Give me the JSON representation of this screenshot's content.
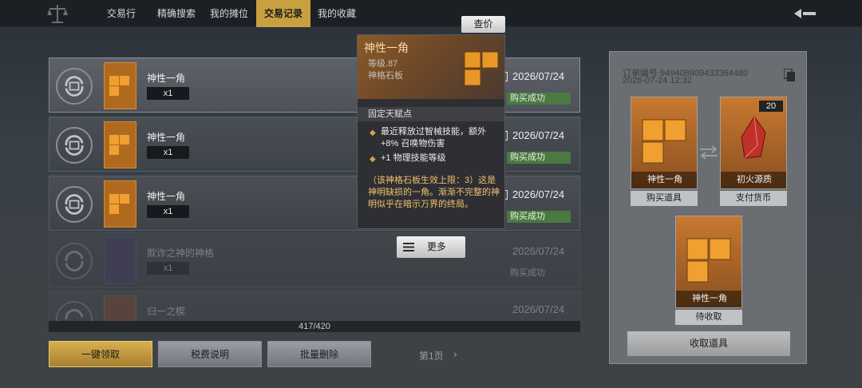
{
  "tabs": [
    {
      "label": "交易行"
    },
    {
      "label": "精确搜索"
    },
    {
      "label": "我的摊位"
    },
    {
      "label": "交易记录"
    },
    {
      "label": "我的收藏"
    }
  ],
  "active_tab_index": 3,
  "records": [
    {
      "name": "神性一角",
      "qty": "x1",
      "date": "2026/07/24",
      "status": "购买成功"
    },
    {
      "name": "神性一角",
      "qty": "x1",
      "date": "2026/07/24",
      "status": "购买成功"
    },
    {
      "name": "神性一角",
      "qty": "x1",
      "date": "2026/07/24",
      "status": "购买成功"
    },
    {
      "name": "欺诈之神的神格",
      "qty": "x1",
      "date": "2026/07/24",
      "status": "购买成功"
    },
    {
      "name": "归一之楔",
      "qty": "",
      "date": "2026/07/24",
      "status": ""
    }
  ],
  "count": "417/420",
  "buttons": {
    "claim_all": "一键领取",
    "tax_info": "税费说明",
    "batch_delete": "批量删除",
    "check_price": "查价",
    "more": "更多",
    "collect_item": "收取道具"
  },
  "pagination": {
    "page": "第1页"
  },
  "tooltip": {
    "title": "神性一角",
    "level": "等级.87",
    "type": "神格石板",
    "section": "固定天赋点",
    "bullets": [
      "最近释放过智械技能，额外 +8% 召唤物伤害",
      "+1 物理技能等级"
    ],
    "flavor": "（该神格石板生效上限：3）这是神明缺损的一角。渐渐不完整的神明似乎在暗示万界的终局。"
  },
  "order": {
    "number": "订单编号 949408909433364480",
    "time": "2026-07-24 12:32",
    "buy_item": {
      "name": "神性一角",
      "caption": "购买道具"
    },
    "currency": {
      "name": "初火源质",
      "caption": "支付货币",
      "amount": "20"
    },
    "pending": {
      "name": "神性一角",
      "caption": "待收取"
    }
  },
  "icons": [
    "scales-logo-icon",
    "back-arrow-icon",
    "refresh-exchange-icon",
    "calendar-icon",
    "copy-icon",
    "swap-arrows-icon",
    "menu-icon",
    "chevron-right-icon"
  ],
  "colors": {
    "accent": "#c8a040",
    "success": "#4a7a42",
    "item_orange": "#b06a20"
  }
}
